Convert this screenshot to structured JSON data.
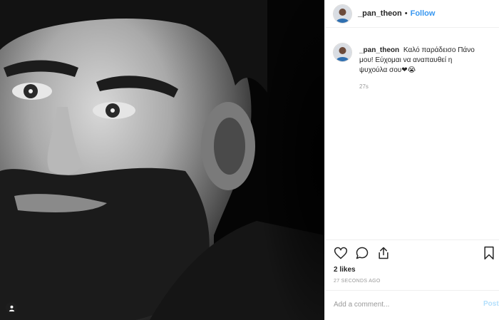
{
  "post": {
    "photo_alt": "black and white portrait",
    "header": {
      "username": "_pan_theon",
      "separator": "•",
      "follow_label": "Follow"
    },
    "caption": {
      "username": "_pan_theon",
      "text": "Καλό παράδεισο Πάνο μου! Εύχομαι να αναπαυθεί η ψυχούλα σου❤😭",
      "time": "27s"
    },
    "actions": {
      "like_icon": "heart-icon",
      "comment_icon": "comment-icon",
      "share_icon": "share-icon",
      "save_icon": "bookmark-icon"
    },
    "likes": "2 likes",
    "posted_ago": "27 SECONDS AGO",
    "comment_input": {
      "placeholder": "Add a comment...",
      "post_label": "Post"
    }
  },
  "colors": {
    "link_blue": "#3897f0",
    "post_disabled": "#b2dffc",
    "border": "#efefef",
    "muted": "#999999"
  }
}
